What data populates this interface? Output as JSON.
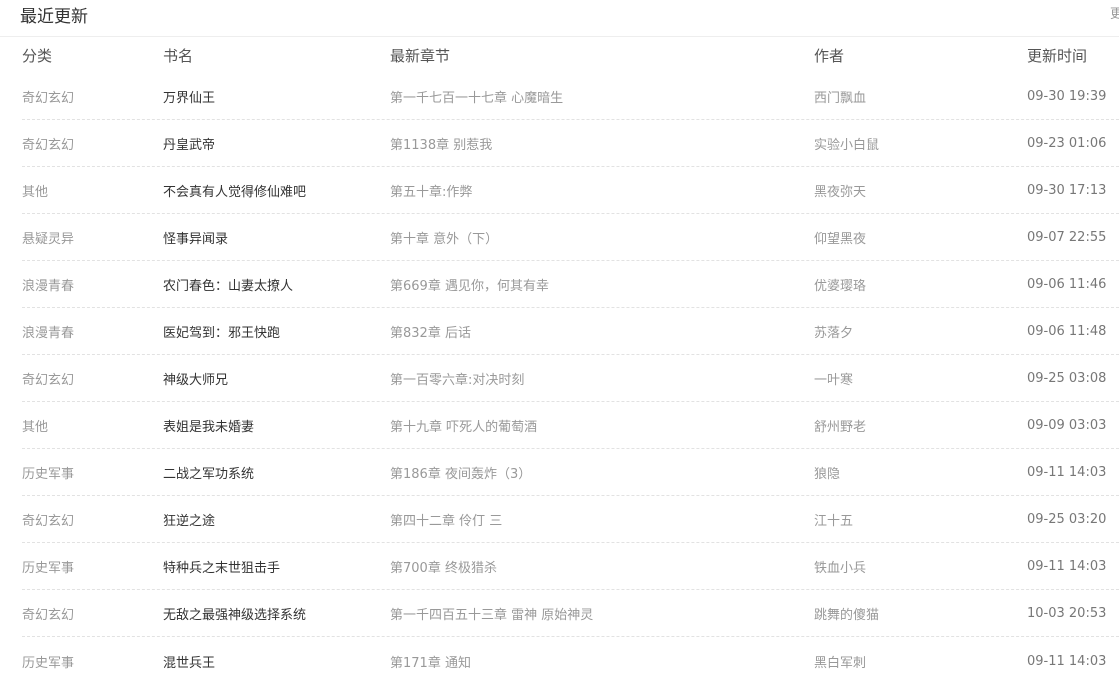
{
  "panel": {
    "title": "最近更新",
    "more_label": "更"
  },
  "table": {
    "headers": {
      "category": "分类",
      "book": "书名",
      "chapter": "最新章节",
      "author": "作者",
      "time": "更新时间"
    },
    "rows": [
      {
        "category": "奇幻玄幻",
        "book": "万界仙王",
        "chapter": "第一千七百一十七章 心魔暗生",
        "author": "西门飘血",
        "time": "09-30 19:39"
      },
      {
        "category": "奇幻玄幻",
        "book": "丹皇武帝",
        "chapter": "第1138章 别惹我",
        "author": "实验小白鼠",
        "time": "09-23 01:06"
      },
      {
        "category": "其他",
        "book": "不会真有人觉得修仙难吧",
        "chapter": "第五十章:作弊",
        "author": "黑夜弥天",
        "time": "09-30 17:13"
      },
      {
        "category": "悬疑灵异",
        "book": "怪事异闻录",
        "chapter": "第十章 意外（下）",
        "author": "仰望黑夜",
        "time": "09-07 22:55"
      },
      {
        "category": "浪漫青春",
        "book": "农门春色：山妻太撩人",
        "chapter": "第669章 遇见你，何其有幸",
        "author": "优婆璎珞",
        "time": "09-06 11:46"
      },
      {
        "category": "浪漫青春",
        "book": "医妃驾到：邪王快跑",
        "chapter": "第832章 后话",
        "author": "苏落夕",
        "time": "09-06 11:48"
      },
      {
        "category": "奇幻玄幻",
        "book": "神级大师兄",
        "chapter": "第一百零六章:对决时刻",
        "author": "一叶寒",
        "time": "09-25 03:08"
      },
      {
        "category": "其他",
        "book": "表姐是我未婚妻",
        "chapter": "第十九章 吓死人的葡萄酒",
        "author": "舒州野老",
        "time": "09-09 03:03"
      },
      {
        "category": "历史军事",
        "book": "二战之军功系统",
        "chapter": "第186章 夜间轰炸（3）",
        "author": "狼隐",
        "time": "09-11 14:03"
      },
      {
        "category": "奇幻玄幻",
        "book": "狂逆之途",
        "chapter": "第四十二章 伶仃 三",
        "author": "江十五",
        "time": "09-25 03:20"
      },
      {
        "category": "历史军事",
        "book": "特种兵之末世狙击手",
        "chapter": "第700章 终极猎杀",
        "author": "铁血小兵",
        "time": "09-11 14:03"
      },
      {
        "category": "奇幻玄幻",
        "book": "无敌之最强神级选择系统",
        "chapter": "第一千四百五十三章 雷神 原始神灵",
        "author": "跳舞的傻猫",
        "time": "10-03 20:53"
      },
      {
        "category": "历史军事",
        "book": "混世兵王",
        "chapter": "第171章 通知",
        "author": "黑白军刺",
        "time": "09-11 14:03"
      }
    ]
  }
}
